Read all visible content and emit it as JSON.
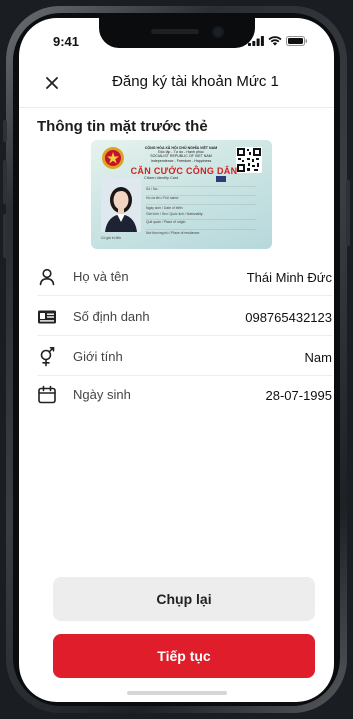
{
  "status_bar": {
    "time": "9:41"
  },
  "header": {
    "title": "Đăng ký tài khoản Mức 1",
    "close_icon": "close-icon"
  },
  "section": {
    "title": "Thông tin mặt trước thẻ"
  },
  "card": {
    "header_line1": "CỘNG HÒA XÃ HỘI CHỦ NGHĨA VIỆT NAM",
    "header_line2": "Độc lập - Tự do - Hạnh phúc",
    "header_line3": "SOCIALIST REPUBLIC OF VIET NAM",
    "header_line4": "Independence - Freedom - Happiness",
    "title": "CĂN CƯỚC CÔNG DÂN",
    "subtitle": "Citizen Identity Card",
    "fields": [
      "Số / No.:",
      "Họ và tên / Full name:",
      "Ngày sinh / Date of birth:",
      "Giới tính / Sex:    Quốc tịch / Nationality:",
      "Quê quán / Place of origin:",
      "Nơi thường trú / Place of residence:"
    ],
    "expiry": "Có giá trị đến"
  },
  "info": [
    {
      "icon": "person-icon",
      "label": "Họ và tên",
      "value": "Thái Minh Đức"
    },
    {
      "icon": "id-card-icon",
      "label": "Số định danh",
      "value": "098765432123"
    },
    {
      "icon": "gender-icon",
      "label": "Giới tính",
      "value": "Nam"
    },
    {
      "icon": "calendar-icon",
      "label": "Ngày sinh",
      "value": "28-07-1995"
    }
  ],
  "buttons": {
    "retake": "Chụp lại",
    "next": "Tiếp tục"
  },
  "colors": {
    "primary": "#e01e2b",
    "secondary_button": "#ededed"
  }
}
